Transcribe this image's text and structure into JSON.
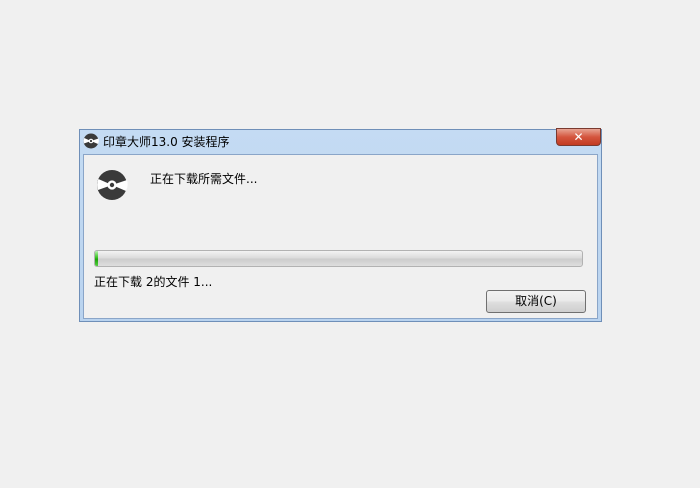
{
  "window": {
    "title": "印章大师13.0 安装程序",
    "close_glyph": "✕"
  },
  "main": {
    "status": "正在下载所需文件...",
    "file_status": "正在下载 2的文件 1...",
    "progress_fraction": 0.005
  },
  "buttons": {
    "cancel_label": "取消(C)"
  },
  "colors": {
    "progress_green": "#37c21f",
    "close_red": "#c23b22",
    "title_bar": "#c4dbf3"
  }
}
